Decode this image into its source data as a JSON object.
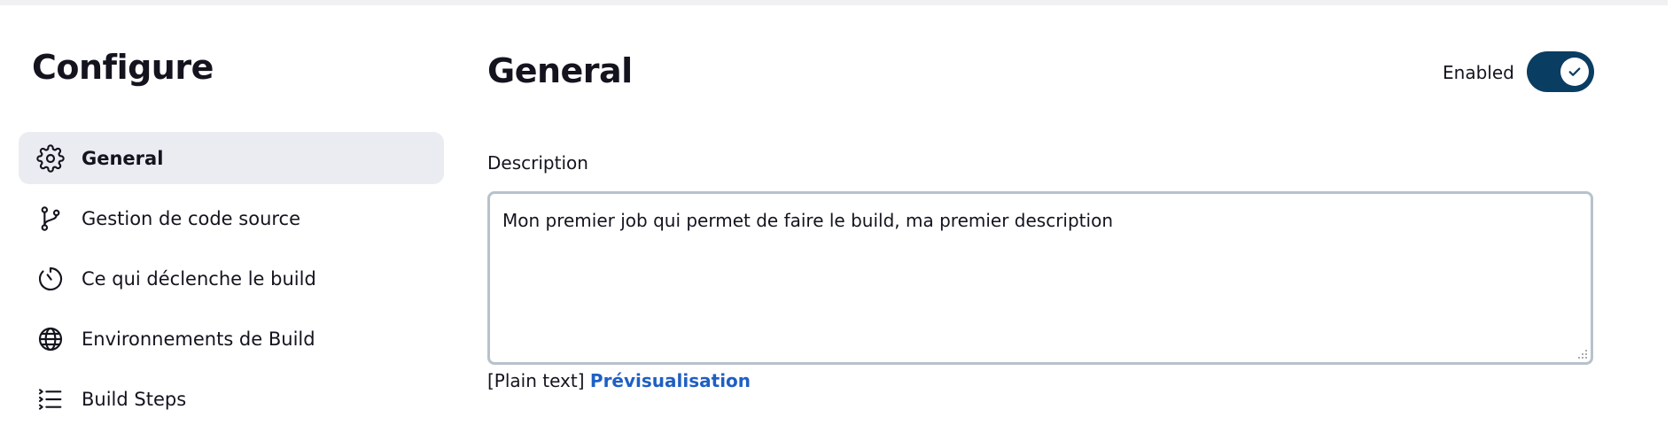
{
  "sidebar": {
    "title": "Configure",
    "items": [
      {
        "label": "General",
        "icon": "gear-icon",
        "active": true
      },
      {
        "label": "Gestion de code source",
        "icon": "branch-icon"
      },
      {
        "label": "Ce qui déclenche le build",
        "icon": "timer-icon"
      },
      {
        "label": "Environnements de Build",
        "icon": "globe-icon"
      },
      {
        "label": "Build Steps",
        "icon": "list-steps-icon"
      }
    ]
  },
  "main": {
    "title": "General",
    "enabled_label": "Enabled",
    "enabled": true,
    "description_label": "Description",
    "description_value": "Mon premier job qui permet de faire le build, ma premier description",
    "format_label": "[Plain text]",
    "preview_link": "Prévisualisation"
  },
  "colors": {
    "toggle_on": "#0a3d62",
    "link": "#1f5fc4",
    "active_item_bg": "#ebecf2"
  }
}
